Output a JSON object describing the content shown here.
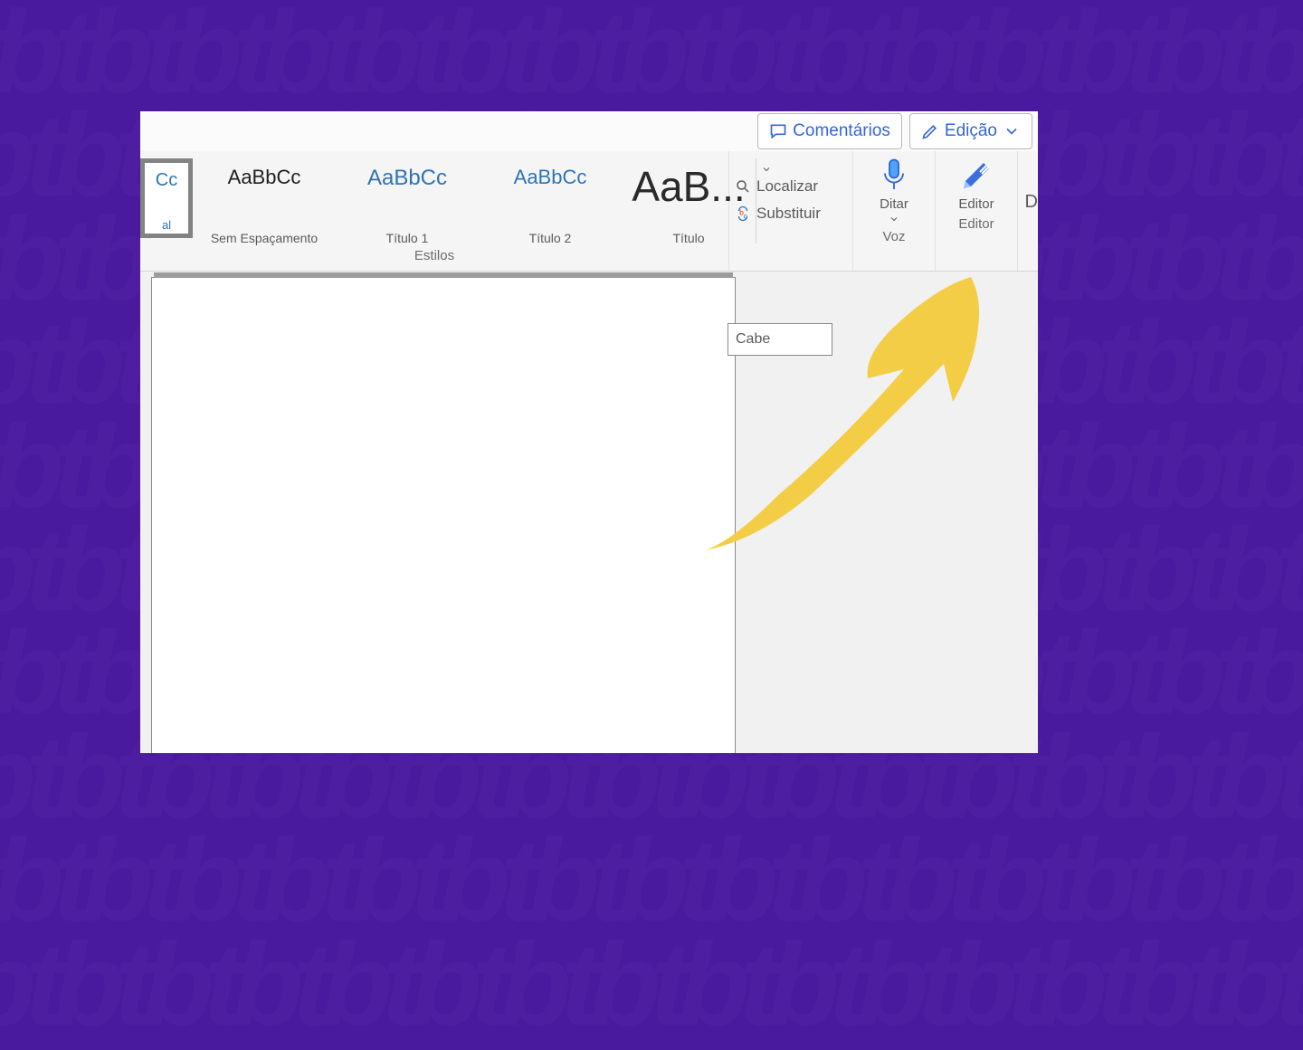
{
  "topbar": {
    "comments": "Comentários",
    "edit_mode": "Edição"
  },
  "styles": {
    "group_label": "Estilos",
    "items": [
      {
        "sample": "Cc",
        "name": "al"
      },
      {
        "sample": "AaBbCc",
        "name": "Sem Espaçamento"
      },
      {
        "sample": "AaBbCc",
        "name": "Título 1"
      },
      {
        "sample": "AaBbCc",
        "name": "Título 2"
      },
      {
        "sample": "AaB...",
        "name": "Título"
      }
    ]
  },
  "editing": {
    "find": "Localizar",
    "replace": "Substituir"
  },
  "voice": {
    "dictate": "Ditar",
    "group_label": "Voz"
  },
  "editor": {
    "label": "Editor",
    "group_label": "Editor"
  },
  "partial_right": "D",
  "doc_header_tag": "Cabe"
}
